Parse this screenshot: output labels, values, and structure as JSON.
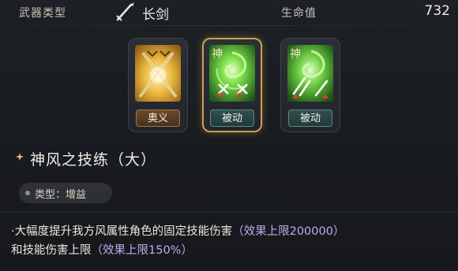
{
  "header": {
    "weapon_type_label": "武器类型",
    "weapon_name": "长剑",
    "hp_label": "生命值",
    "hp_value": "732",
    "weapon_icon": "sword-icon"
  },
  "skill_cards": [
    {
      "tag": "奥义",
      "tag_color": "#4a3020",
      "art": "crossed-swords-golden"
    },
    {
      "tag": "被动",
      "tag_color": "#213a39",
      "art": "wind-vortex-crosses",
      "badge": "神",
      "selected": true
    },
    {
      "tag": "被动",
      "tag_color": "#213a39",
      "art": "wind-vortex-swords",
      "badge": "神"
    }
  ],
  "skill": {
    "title": "神风之技练（大）",
    "type_label": "类型：增益",
    "desc_prefix": "·大幅度提升我方风属性角色的固定技能伤害",
    "desc_hl1": "（效果上限200000）",
    "desc_mid": "和技能伤害上限",
    "desc_hl2": "（效果上限150%）"
  },
  "colors": {
    "accent_gold": "#c9a24d",
    "highlight_text": "#b8b1ea",
    "wind_green": "#5fcf3a"
  }
}
